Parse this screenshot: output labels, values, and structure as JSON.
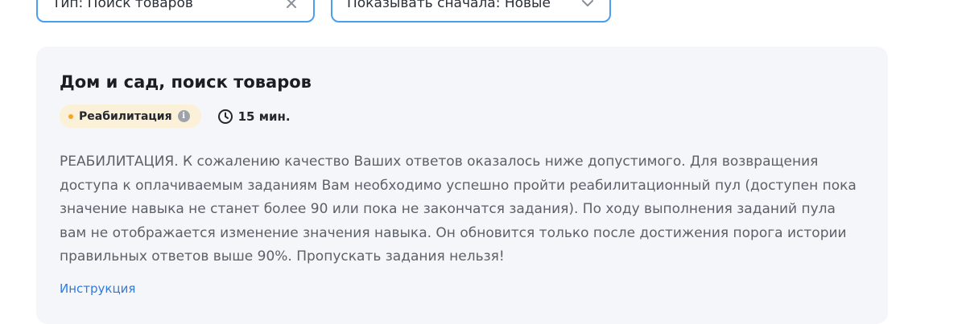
{
  "filters": {
    "type_label": "Тип: Поиск товаров",
    "sort_label": "Показывать сначала: Новые"
  },
  "card": {
    "title": "Дом и сад, поиск товаров",
    "badge": {
      "label": "Реабилитация",
      "dot_color": "#f5a623",
      "info_icon": "i"
    },
    "duration": "15 мин.",
    "description": "РЕАБИЛИТАЦИЯ. К сожалению качество Ваших ответов оказалось ниже допустимого. Для возвращения доступа к оплачиваемым заданиям Вам необходимо успешно пройти реабилитационный пул (доступен пока значение навыка не станет более 90 или пока не закончатся задания). По ходу выполнения заданий пула вам не отображается изменение значения навыка. Он обновится только после достижения порога истории правильных ответов выше 90%. Пропускать задания нельзя!",
    "instruction_link": "Инструкция"
  },
  "colors": {
    "accent": "#4a9ef0",
    "link": "#2d7be0",
    "badge_bg": "#fbf1d9",
    "card_bg": "#f5f6f9"
  }
}
